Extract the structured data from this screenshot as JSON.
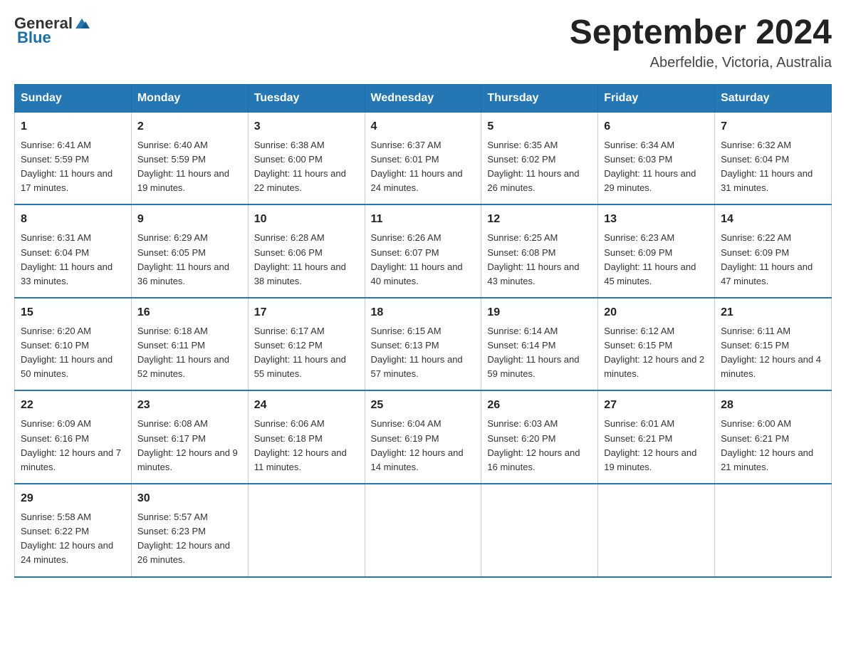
{
  "logo": {
    "text_general": "General",
    "text_blue": "Blue"
  },
  "title": "September 2024",
  "location": "Aberfeldie, Victoria, Australia",
  "days_of_week": [
    "Sunday",
    "Monday",
    "Tuesday",
    "Wednesday",
    "Thursday",
    "Friday",
    "Saturday"
  ],
  "weeks": [
    [
      {
        "day": "1",
        "sunrise": "6:41 AM",
        "sunset": "5:59 PM",
        "daylight": "11 hours and 17 minutes."
      },
      {
        "day": "2",
        "sunrise": "6:40 AM",
        "sunset": "5:59 PM",
        "daylight": "11 hours and 19 minutes."
      },
      {
        "day": "3",
        "sunrise": "6:38 AM",
        "sunset": "6:00 PM",
        "daylight": "11 hours and 22 minutes."
      },
      {
        "day": "4",
        "sunrise": "6:37 AM",
        "sunset": "6:01 PM",
        "daylight": "11 hours and 24 minutes."
      },
      {
        "day": "5",
        "sunrise": "6:35 AM",
        "sunset": "6:02 PM",
        "daylight": "11 hours and 26 minutes."
      },
      {
        "day": "6",
        "sunrise": "6:34 AM",
        "sunset": "6:03 PM",
        "daylight": "11 hours and 29 minutes."
      },
      {
        "day": "7",
        "sunrise": "6:32 AM",
        "sunset": "6:04 PM",
        "daylight": "11 hours and 31 minutes."
      }
    ],
    [
      {
        "day": "8",
        "sunrise": "6:31 AM",
        "sunset": "6:04 PM",
        "daylight": "11 hours and 33 minutes."
      },
      {
        "day": "9",
        "sunrise": "6:29 AM",
        "sunset": "6:05 PM",
        "daylight": "11 hours and 36 minutes."
      },
      {
        "day": "10",
        "sunrise": "6:28 AM",
        "sunset": "6:06 PM",
        "daylight": "11 hours and 38 minutes."
      },
      {
        "day": "11",
        "sunrise": "6:26 AM",
        "sunset": "6:07 PM",
        "daylight": "11 hours and 40 minutes."
      },
      {
        "day": "12",
        "sunrise": "6:25 AM",
        "sunset": "6:08 PM",
        "daylight": "11 hours and 43 minutes."
      },
      {
        "day": "13",
        "sunrise": "6:23 AM",
        "sunset": "6:09 PM",
        "daylight": "11 hours and 45 minutes."
      },
      {
        "day": "14",
        "sunrise": "6:22 AM",
        "sunset": "6:09 PM",
        "daylight": "11 hours and 47 minutes."
      }
    ],
    [
      {
        "day": "15",
        "sunrise": "6:20 AM",
        "sunset": "6:10 PM",
        "daylight": "11 hours and 50 minutes."
      },
      {
        "day": "16",
        "sunrise": "6:18 AM",
        "sunset": "6:11 PM",
        "daylight": "11 hours and 52 minutes."
      },
      {
        "day": "17",
        "sunrise": "6:17 AM",
        "sunset": "6:12 PM",
        "daylight": "11 hours and 55 minutes."
      },
      {
        "day": "18",
        "sunrise": "6:15 AM",
        "sunset": "6:13 PM",
        "daylight": "11 hours and 57 minutes."
      },
      {
        "day": "19",
        "sunrise": "6:14 AM",
        "sunset": "6:14 PM",
        "daylight": "11 hours and 59 minutes."
      },
      {
        "day": "20",
        "sunrise": "6:12 AM",
        "sunset": "6:15 PM",
        "daylight": "12 hours and 2 minutes."
      },
      {
        "day": "21",
        "sunrise": "6:11 AM",
        "sunset": "6:15 PM",
        "daylight": "12 hours and 4 minutes."
      }
    ],
    [
      {
        "day": "22",
        "sunrise": "6:09 AM",
        "sunset": "6:16 PM",
        "daylight": "12 hours and 7 minutes."
      },
      {
        "day": "23",
        "sunrise": "6:08 AM",
        "sunset": "6:17 PM",
        "daylight": "12 hours and 9 minutes."
      },
      {
        "day": "24",
        "sunrise": "6:06 AM",
        "sunset": "6:18 PM",
        "daylight": "12 hours and 11 minutes."
      },
      {
        "day": "25",
        "sunrise": "6:04 AM",
        "sunset": "6:19 PM",
        "daylight": "12 hours and 14 minutes."
      },
      {
        "day": "26",
        "sunrise": "6:03 AM",
        "sunset": "6:20 PM",
        "daylight": "12 hours and 16 minutes."
      },
      {
        "day": "27",
        "sunrise": "6:01 AM",
        "sunset": "6:21 PM",
        "daylight": "12 hours and 19 minutes."
      },
      {
        "day": "28",
        "sunrise": "6:00 AM",
        "sunset": "6:21 PM",
        "daylight": "12 hours and 21 minutes."
      }
    ],
    [
      {
        "day": "29",
        "sunrise": "5:58 AM",
        "sunset": "6:22 PM",
        "daylight": "12 hours and 24 minutes."
      },
      {
        "day": "30",
        "sunrise": "5:57 AM",
        "sunset": "6:23 PM",
        "daylight": "12 hours and 26 minutes."
      },
      null,
      null,
      null,
      null,
      null
    ]
  ]
}
